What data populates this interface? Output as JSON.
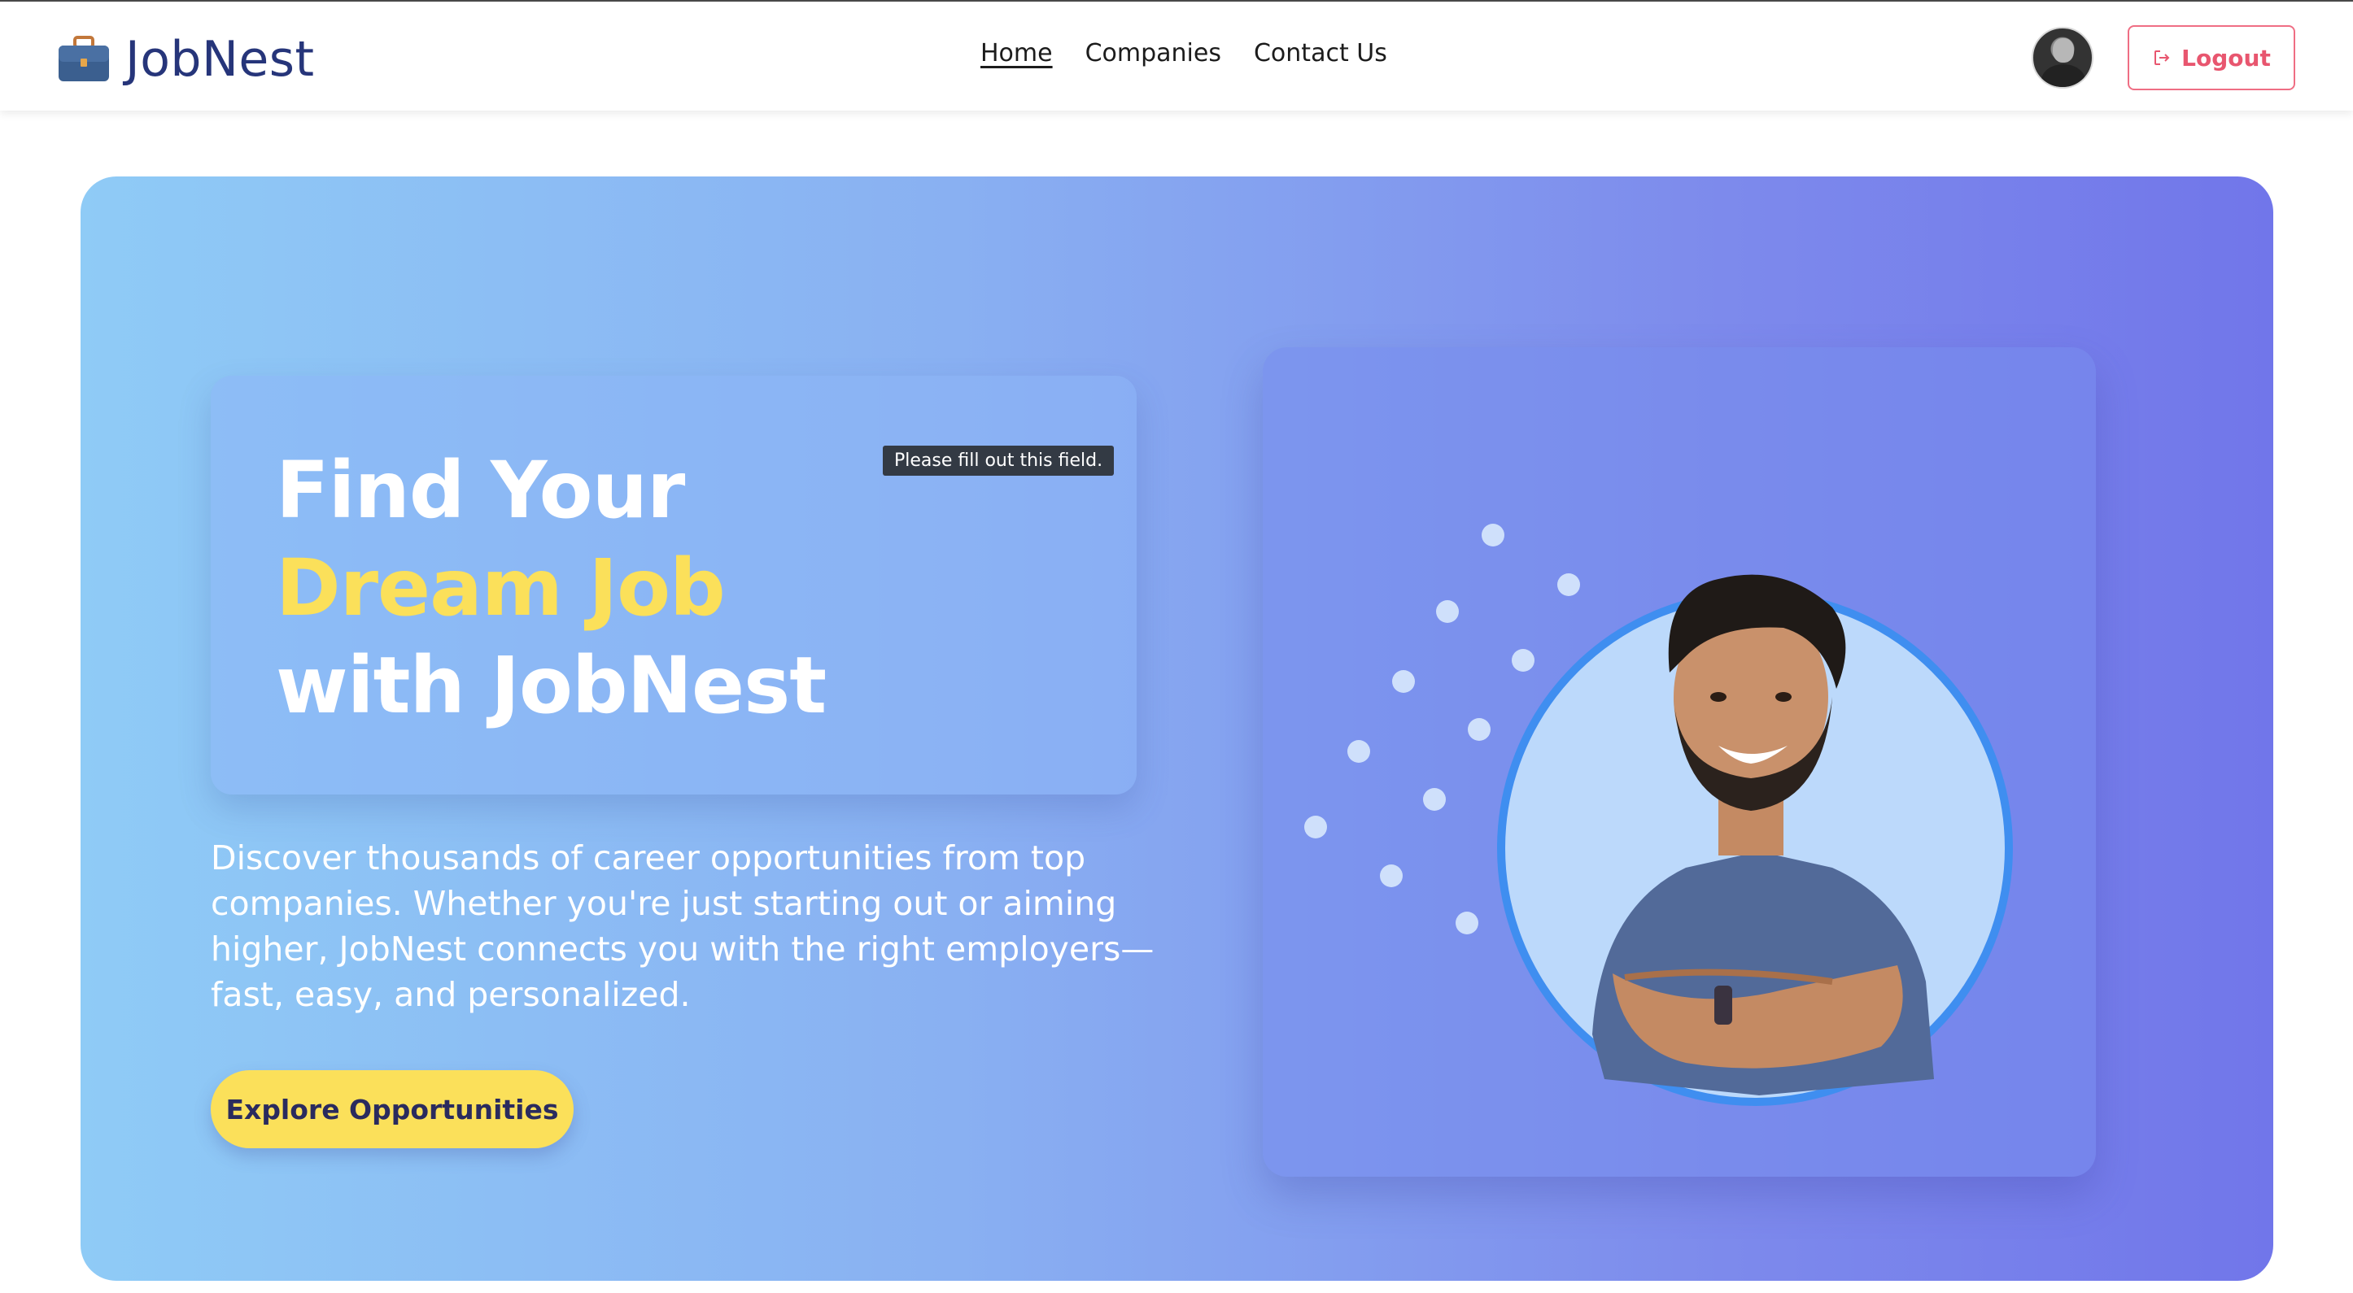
{
  "brand": {
    "name": "JobNest",
    "logo_icon": "briefcase-icon"
  },
  "nav": {
    "links": [
      {
        "label": "Home",
        "active": true
      },
      {
        "label": "Companies",
        "active": false
      },
      {
        "label": "Contact Us",
        "active": false
      }
    ]
  },
  "user": {
    "avatar_icon": "user-avatar"
  },
  "logout": {
    "label": "Logout",
    "icon": "logout-icon",
    "color": "#e8566f"
  },
  "hero": {
    "title_line1": "Find Your",
    "title_line2": "Dream Job",
    "title_line3": "with JobNest",
    "tooltip": "Please fill out this field.",
    "description": "Discover thousands of career opportunities from top companies. Whether you're just starting out or aiming higher, JobNest connects you with the right employers—fast, easy, and personalized.",
    "cta_label": "Explore Opportunities",
    "accent_color": "#fbe05a",
    "gradient_start": "#8fcbf6",
    "gradient_end": "#7176ea"
  }
}
